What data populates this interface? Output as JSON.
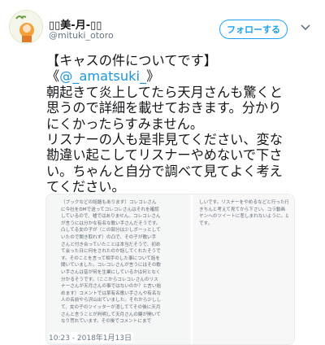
{
  "user": {
    "display_name": "▯▯美-月-▯▯",
    "handle": "@mituki_otoro",
    "follow_label": "フォローする"
  },
  "tweet": {
    "line1": "【キャスの件についてです】",
    "line2_prefix": "《",
    "mention": "@_amatsuki_",
    "line2_suffix": "》",
    "line3": "朝起きて炎上してたら天月さんも驚くと",
    "line4": "思うので詳細を載せておきます。分かり",
    "line5": "にくかったらすみません。",
    "line6": "リスナーの人も是非見てください、変な",
    "line7": "勘違い起こしてリスナーやめないで下さ",
    "line8": "い。ちゃんと自分で調べて見てよく考え",
    "line9": "てください。"
  },
  "media": {
    "left_lines": [
      "（ブックなどの話題もあります）コレコレさん",
      "に今社をDMで送ってコレコレさんはそれを確認",
      "しているので、嘘ではありません。コレコレさん",
      "が言うには分かな有名な歌い手さんだそうです。",
      "凸してる女の子が（この部分は少しボーッとして",
      "いたので聞き取れず）の凸で、その子が歌い手",
      "さんと付き合っていたことは本当だそうで、初め",
      "て会った日に何をされたのか話してくれたそうで",
      "す。そのことを言って相手のした事について話を",
      "聞いていました。コレコレさんが言うにはその歌",
      "い手さんは昔が何を生業にしているかは何となく",
      "分かるそうです。（ここからコレコレさんのリス",
      "ナーさんが天月さんの事ではないのか？と言い始",
      "めます）コメントでは某有名歌い手さんや有名な",
      "人の名前やら沢山出ていました。それから少しし",
      "て、女の子のツイッターが消しててその後に天月",
      "さんと言うことが判明して天月さんの鍵が開いて",
      "なり荒れています。その後でコメントにまで"
    ],
    "right_lines": [
      "しいです。リスナーをやめるなどと行った行為は",
      "きちんと考えて見てから下さい。コラ動画",
      "ヤンへのツイートに悲しまれないように。以上",
      "です。"
    ]
  },
  "timestamp": "10:23 - 2018年1月13日"
}
